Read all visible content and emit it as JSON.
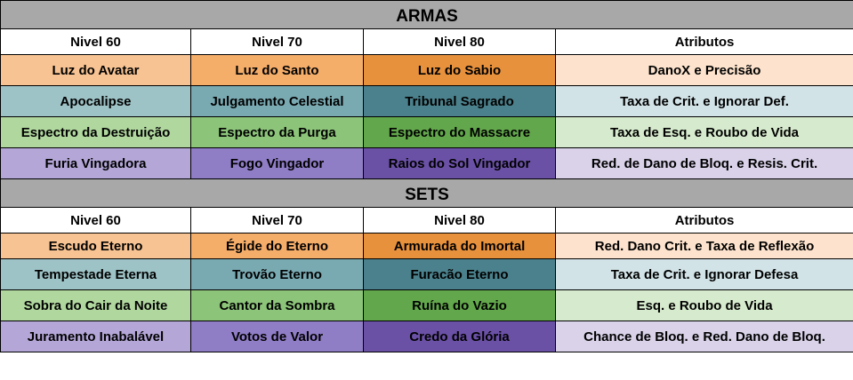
{
  "colors": {
    "section_bg": "#a8a8a8",
    "orange": [
      "#f8c392",
      "#f5ad6a",
      "#e8913d",
      "#fde3cd"
    ],
    "teal": [
      "#9ec3c6",
      "#79aab2",
      "#4b818c",
      "#d2e3e7"
    ],
    "green": [
      "#b0d79e",
      "#8cc479",
      "#62a74b",
      "#d6eacd"
    ],
    "purple": [
      "#b4a7d8",
      "#8f7dc6",
      "#6a51a6",
      "#d9d2e9"
    ]
  },
  "sections": [
    {
      "title": "ARMAS",
      "headers": [
        "Nivel 60",
        "Nivel 70",
        "Nivel 80",
        "Atributos"
      ],
      "rows": [
        {
          "color": "orange",
          "cells": [
            "Luz do Avatar",
            "Luz do Santo",
            "Luz do Sabio",
            "DanoX e Precisão"
          ]
        },
        {
          "color": "teal",
          "cells": [
            "Apocalipse",
            "Julgamento Celestial",
            "Tribunal Sagrado",
            "Taxa de Crit. e Ignorar Def."
          ]
        },
        {
          "color": "green",
          "cells": [
            "Espectro da Destruição",
            "Espectro da Purga",
            "Espectro do Massacre",
            "Taxa de Esq. e Roubo de Vida"
          ]
        },
        {
          "color": "purple",
          "cells": [
            "Furia Vingadora",
            "Fogo Vingador",
            "Raios do Sol Vingador",
            "Red. de Dano de Bloq. e Resis. Crit."
          ]
        }
      ]
    },
    {
      "title": "SETS",
      "headers": [
        "Nivel 60",
        "Nivel 70",
        "Nivel 80",
        "Atributos"
      ],
      "rows": [
        {
          "color": "orange",
          "cells": [
            "Escudo Eterno",
            "Égide do Eterno",
            "Armurada do Imortal",
            "Red. Dano Crit. e Taxa de Reflexão"
          ]
        },
        {
          "color": "teal",
          "cells": [
            "Tempestade Eterna",
            "Trovão Eterno",
            "Furacão Eterno",
            "Taxa de Crit. e Ignorar Defesa"
          ]
        },
        {
          "color": "green",
          "cells": [
            "Sobra do Cair da Noite",
            "Cantor da Sombra",
            "Ruína do Vazio",
            "Esq. e Roubo de Vida"
          ]
        },
        {
          "color": "purple",
          "cells": [
            "Juramento Inabalável",
            "Votos de Valor",
            "Credo da Glória",
            "Chance de Bloq. e Red. Dano de Bloq."
          ]
        }
      ]
    }
  ]
}
